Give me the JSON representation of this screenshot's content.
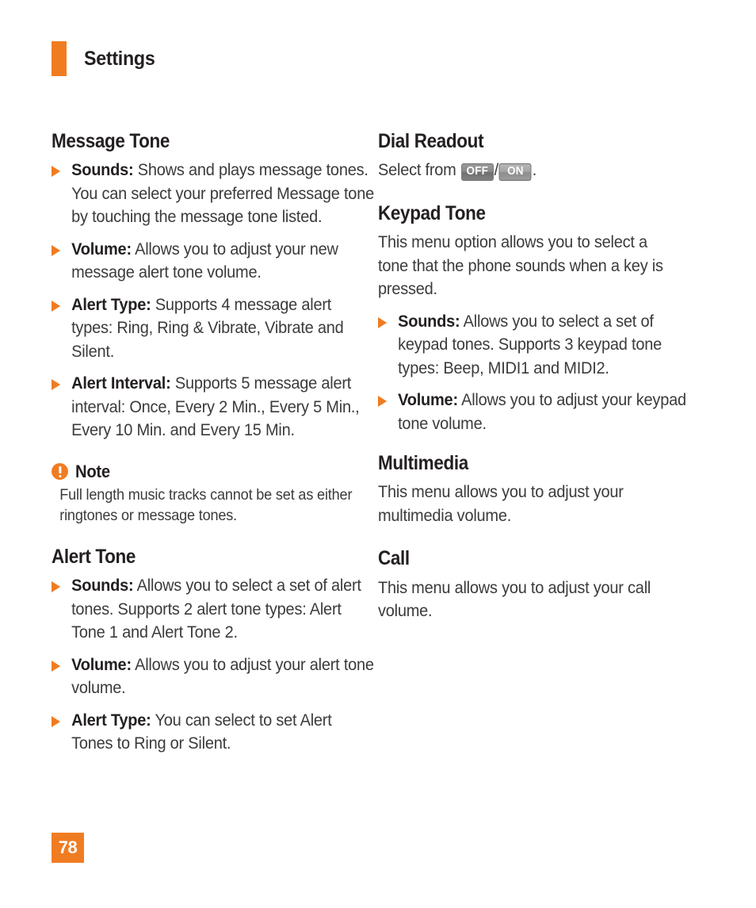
{
  "header": {
    "title": "Settings",
    "accent_color": "#F07C22"
  },
  "left_column": {
    "sections": [
      {
        "title": "Message Tone",
        "bullets": [
          {
            "label": "Sounds:",
            "text": " Shows and plays message tones. You can select your preferred Message tone by touching the message tone listed."
          },
          {
            "label": "Volume:",
            "text": " Allows you to adjust your new message alert tone volume."
          },
          {
            "label": "Alert Type:",
            "text": " Supports 4 message alert types: Ring, Ring & Vibrate, Vibrate and Silent."
          },
          {
            "label": "Alert Interval:",
            "text": " Supports 5 message alert interval: Once, Every 2 Min., Every 5 Min., Every 10 Min. and Every 15 Min."
          }
        ],
        "note": {
          "title": "Note",
          "body": "Full length music tracks cannot be set as either ringtones or message tones."
        }
      },
      {
        "title": "Alert Tone",
        "bullets": [
          {
            "label": "Sounds:",
            "text": " Allows you to select a set of alert tones. Supports 2 alert tone types: Alert Tone 1 and Alert Tone 2."
          },
          {
            "label": "Volume:",
            "text": " Allows you to adjust your alert tone volume."
          },
          {
            "label": "Alert Type:",
            "text": " You can select to set Alert Tones to Ring or Silent."
          }
        ]
      }
    ]
  },
  "right_column": {
    "dial_readout": {
      "title": "Dial Readout",
      "text_before": "Select from ",
      "badge_off": "OFF",
      "separator": "/",
      "badge_on": "ON",
      "text_after": "."
    },
    "keypad_tone": {
      "title": "Keypad Tone",
      "intro": "This menu option allows you to select a tone that the phone sounds when a key is pressed.",
      "bullets": [
        {
          "label": "Sounds:",
          "text": " Allows you to select a set of keypad tones. Supports 3 keypad tone types: Beep, MIDI1 and MIDI2."
        },
        {
          "label": "Volume:",
          "text": " Allows you to adjust your keypad tone volume."
        }
      ]
    },
    "multimedia": {
      "title": "Multimedia",
      "text": "This menu allows you to adjust your multimedia volume."
    },
    "call": {
      "title": "Call",
      "text": "This menu allows you to adjust your call volume."
    }
  },
  "footer": {
    "page_number": "78"
  }
}
